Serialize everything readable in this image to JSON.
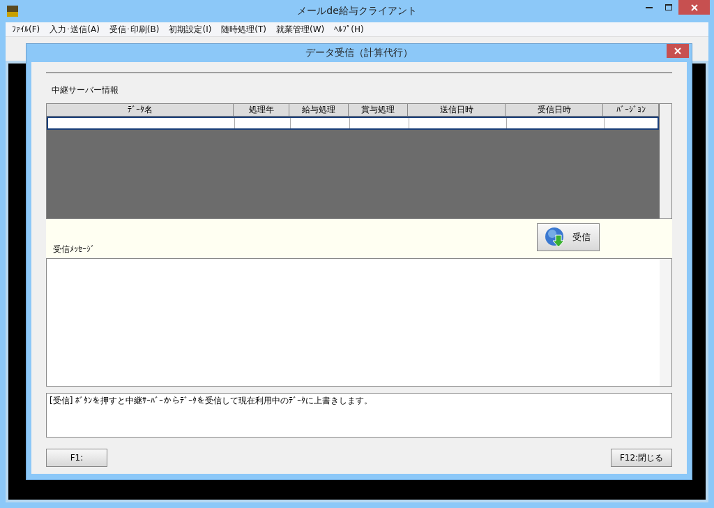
{
  "window": {
    "title": "メールde給与クライアント"
  },
  "menu": [
    "ﾌｧｲﾙ(F)",
    "入力･送信(A)",
    "受信･印刷(B)",
    "初期設定(I)",
    "随時処理(T)",
    "就業管理(W)",
    "ﾍﾙﾌﾟ(H)"
  ],
  "dialog": {
    "title": "データ受信（計算代行）",
    "section_label": "中継サーバー情報",
    "table": {
      "columns": [
        "ﾃﾞｰﾀ名",
        "処理年",
        "給与処理",
        "賞与処理",
        "送信日時",
        "受信日時",
        "ﾊﾞｰｼﾞｮﾝ"
      ]
    },
    "message_label": "受信ﾒｯｾｰｼﾞ",
    "receive_button": "受信",
    "hint": "[受信] ﾎﾞﾀﾝを押すと中継ｻｰﾊﾞｰからﾃﾞｰﾀを受信して現在利用中のﾃﾞｰﾀに上書きします。",
    "buttons": [
      "F1:",
      "F12:閉じる"
    ]
  }
}
